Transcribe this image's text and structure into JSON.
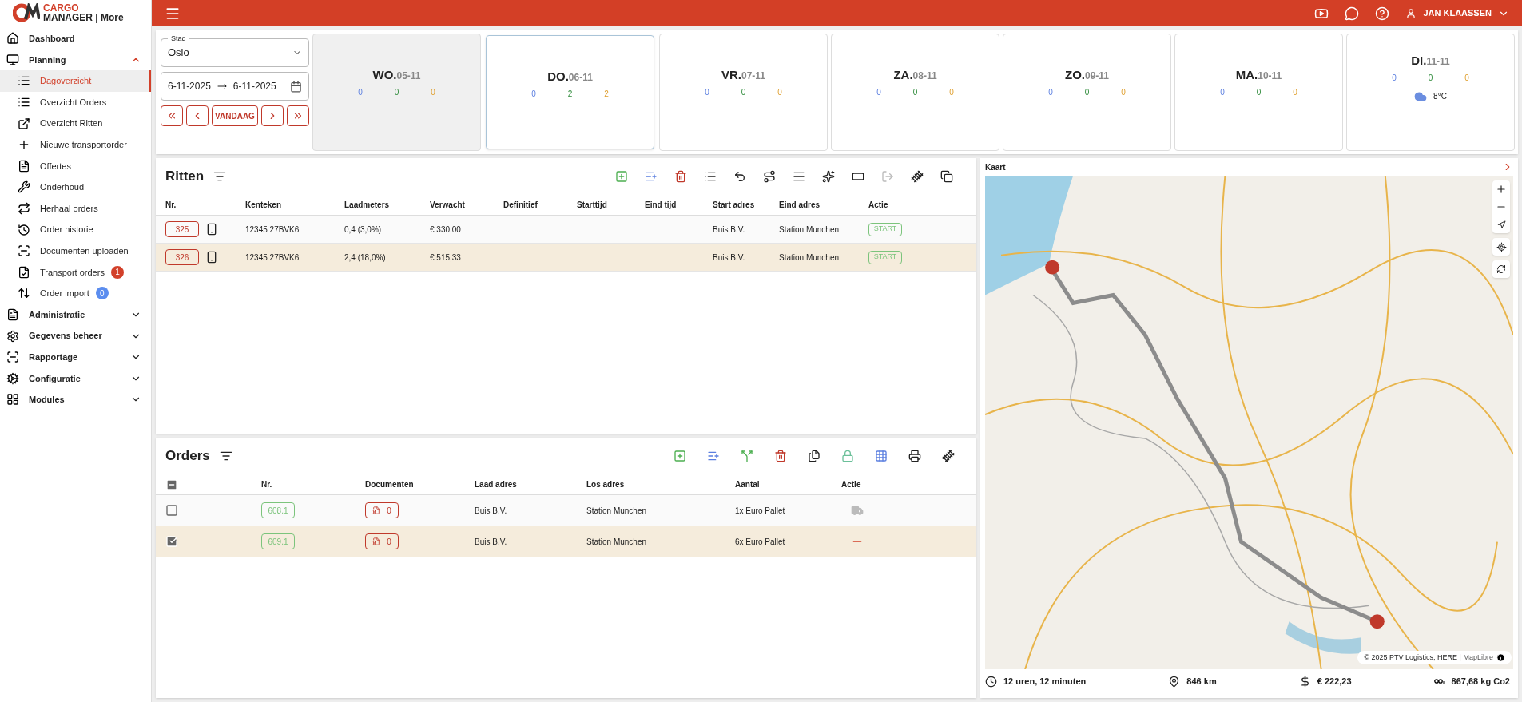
{
  "brand": {
    "line1": "CARGO",
    "line2": "MANAGER | More"
  },
  "header": {
    "user": "JAN KLAASSEN"
  },
  "sidebar": {
    "items": [
      {
        "label": "Dashboard",
        "selected": false
      },
      {
        "label": "Planning",
        "selected": false,
        "expanded": true,
        "children": [
          {
            "label": "Dagoverzicht",
            "selected": true
          },
          {
            "label": "Overzicht Orders",
            "selected": false
          },
          {
            "label": "Overzicht Ritten",
            "selected": false
          },
          {
            "label": "Nieuwe transportorder",
            "selected": false
          },
          {
            "label": "Offertes",
            "selected": false
          },
          {
            "label": "Onderhoud",
            "selected": false
          },
          {
            "label": "Herhaal orders",
            "selected": false
          },
          {
            "label": "Order historie",
            "selected": false
          },
          {
            "label": "Documenten uploaden",
            "selected": false
          },
          {
            "label": "Transport orders",
            "selected": false,
            "badge": "1",
            "color": "#d2402a"
          },
          {
            "label": "Order import",
            "selected": false,
            "badge": "0",
            "color": "#5b8def"
          }
        ]
      },
      {
        "label": "Administratie",
        "selected": false,
        "expanded": false
      },
      {
        "label": "Gegevens beheer",
        "selected": false,
        "expanded": false
      },
      {
        "label": "Rapportage",
        "selected": false,
        "expanded": false
      },
      {
        "label": "Configuratie",
        "selected": false,
        "expanded": false
      },
      {
        "label": "Modules",
        "selected": false,
        "expanded": false
      }
    ]
  },
  "filter": {
    "city_label": "Stad",
    "city": "Oslo",
    "date_from": "6-11-2025",
    "date_to": "6-11-2025",
    "today": "VANDAAG"
  },
  "days": [
    {
      "day": "WO.",
      "date": "05-11",
      "counts": [
        "0",
        "0",
        "0"
      ],
      "selected": false,
      "past": true
    },
    {
      "day": "DO.",
      "date": "06-11",
      "counts": [
        "0",
        "2",
        "2"
      ],
      "selected": true,
      "past": false
    },
    {
      "day": "VR.",
      "date": "07-11",
      "counts": [
        "0",
        "0",
        "0"
      ],
      "selected": false,
      "past": false
    },
    {
      "day": "ZA.",
      "date": "08-11",
      "counts": [
        "0",
        "0",
        "0"
      ],
      "selected": false,
      "past": false
    },
    {
      "day": "ZO.",
      "date": "09-11",
      "counts": [
        "0",
        "0",
        "0"
      ],
      "selected": false,
      "past": false
    },
    {
      "day": "MA.",
      "date": "10-11",
      "counts": [
        "0",
        "0",
        "0"
      ],
      "selected": false,
      "past": false
    },
    {
      "day": "DI.",
      "date": "11-11",
      "counts": [
        "0",
        "0",
        "0"
      ],
      "selected": false,
      "past": false,
      "temp": "8°C"
    }
  ],
  "ritten": {
    "title": "Ritten",
    "columns": [
      "Nr.",
      "Kenteken",
      "Laadmeters",
      "Verwacht",
      "Definitief",
      "Starttijd",
      "Eind tijd",
      "Start adres",
      "Eind adres",
      "Actie"
    ],
    "rows": [
      {
        "nr": "325",
        "kenteken": "12345 27BVK6",
        "laadmeters": "0,4 (3,0%)",
        "verwacht": "€ 330,00",
        "start": "Buis B.V.",
        "eind": "Station Munchen",
        "action": "START",
        "selected": false
      },
      {
        "nr": "326",
        "kenteken": "12345 27BVK6",
        "laadmeters": "2,4 (18,0%)",
        "verwacht": "€ 515,33",
        "start": "Buis B.V.",
        "eind": "Station Munchen",
        "action": "START",
        "selected": true
      }
    ]
  },
  "orders": {
    "title": "Orders",
    "select_all": {
      "indeterminate": true
    },
    "columns": [
      "Nr.",
      "Documenten",
      "Laad adres",
      "Los adres",
      "Aantal",
      "Actie"
    ],
    "rows": [
      {
        "nr": "608.1",
        "docs": "0",
        "laad": "Buis B.V.",
        "los": "Station Munchen",
        "aantal": "1x Euro Pallet",
        "checked": false,
        "selected": false,
        "kind": "truck"
      },
      {
        "nr": "609.1",
        "docs": "0",
        "laad": "Buis B.V.",
        "los": "Station Munchen",
        "aantal": "6x Euro Pallet",
        "checked": true,
        "selected": true,
        "kind": "dash"
      }
    ]
  },
  "map": {
    "title": "Kaart",
    "attribution": "© 2025 PTV Logistics, HERE | ",
    "attribution_link": "MapLibre",
    "stats": [
      {
        "kind": "time",
        "text": "12 uren, 12 minuten"
      },
      {
        "kind": "distance",
        "text": "846 km"
      },
      {
        "kind": "cost",
        "text": "€ 222,23"
      },
      {
        "kind": "co2",
        "text": "867,68 kg Co2"
      }
    ]
  }
}
